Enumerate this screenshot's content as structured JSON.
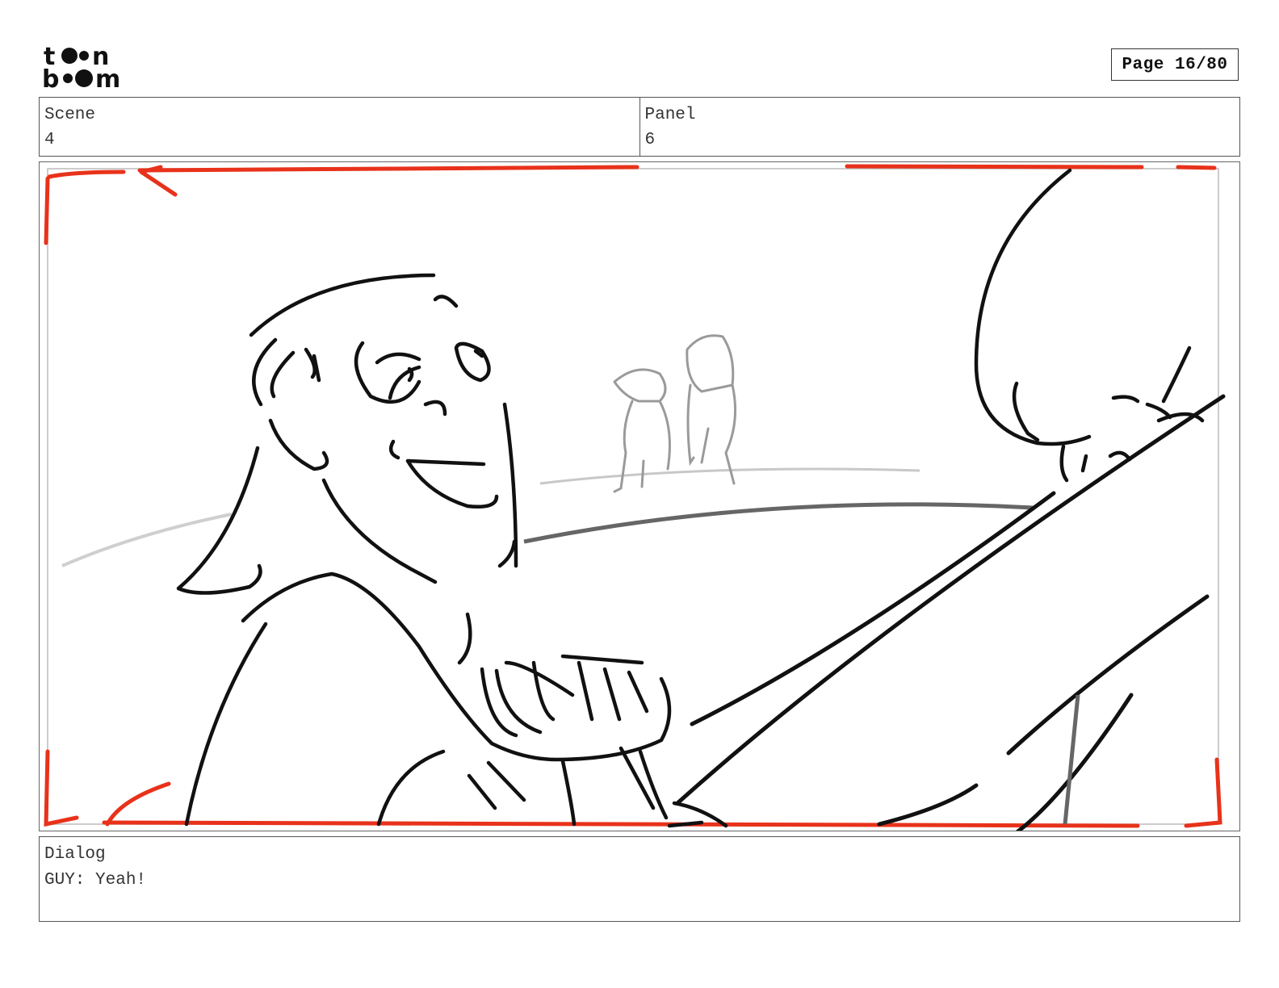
{
  "page": {
    "label": "Page 16/80"
  },
  "scene": {
    "label": "Scene",
    "value": "4"
  },
  "panel": {
    "label": "Panel",
    "value": "6"
  },
  "dialog": {
    "label": "Dialog",
    "text": "GUY: Yeah!"
  },
  "logo": {
    "text": "toon boom"
  },
  "colors": {
    "frame_guide": "#e8321b",
    "ink": "#111111",
    "background_figures": "#9a9a9a"
  }
}
